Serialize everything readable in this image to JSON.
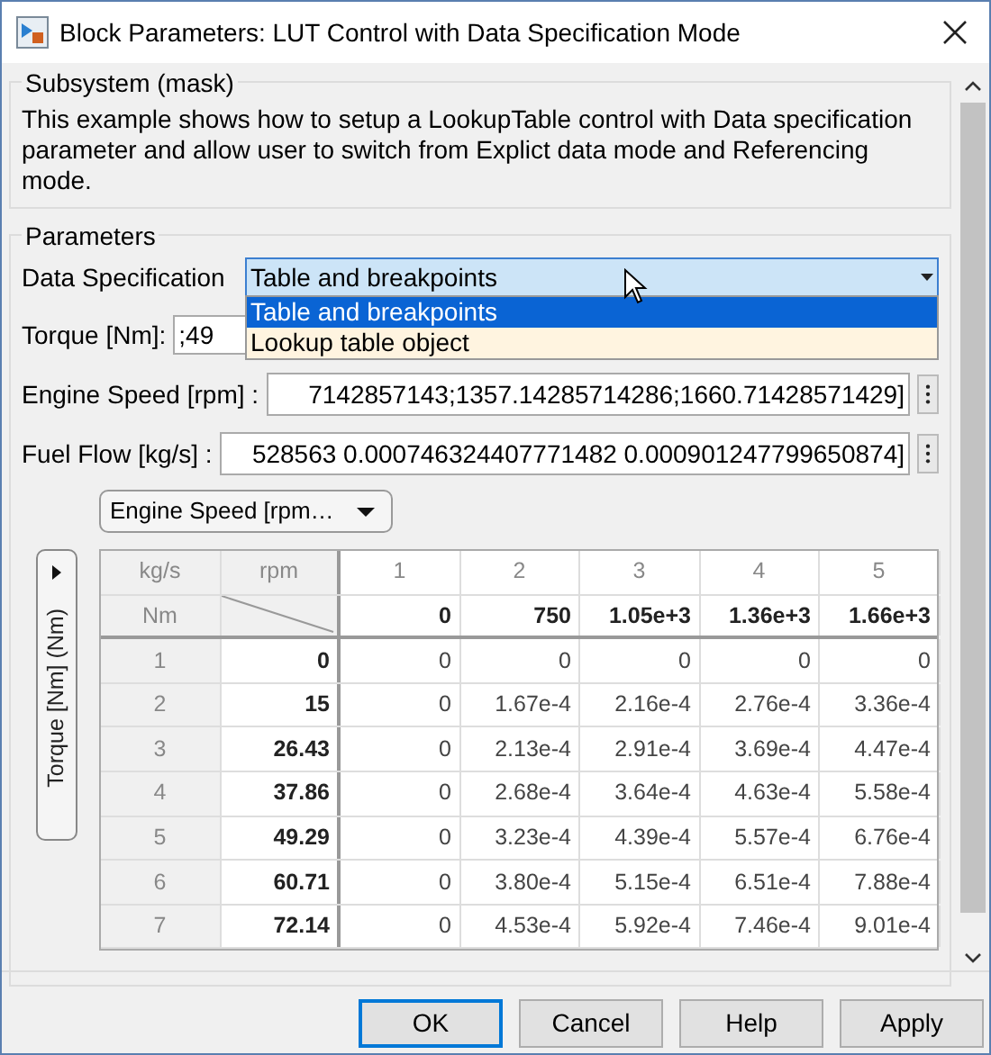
{
  "window": {
    "title": "Block Parameters: LUT Control with Data Specification Mode"
  },
  "description_group": {
    "title": "Subsystem (mask)",
    "text": "This example shows how to setup a LookupTable control with Data specification parameter and allow user to switch from Explict data mode and Referencing mode."
  },
  "parameters": {
    "title": "Parameters",
    "data_specification": {
      "label": "Data Specification",
      "value": "Table and breakpoints",
      "expanded": true,
      "options": [
        {
          "label": "Table and breakpoints",
          "selected": true
        },
        {
          "label": "Lookup table object",
          "selected": false
        }
      ]
    },
    "fields": [
      {
        "label": "Torque [Nm]:",
        "value": ";49"
      },
      {
        "label": "Engine Speed [rpm] :",
        "value": "7142857143;1357.14285714286;1660.71428571429]"
      },
      {
        "label": "Fuel Flow [kg/s] :",
        "value": "528563 0.000746324407771482 0.000901247799650874]"
      }
    ]
  },
  "axis_selector": {
    "value": "Engine Speed [rpm…"
  },
  "side_toggle": {
    "label": "Torque [Nm] (Nm)"
  },
  "table": {
    "corner": {
      "top_left": "kg/s",
      "top_right": "rpm",
      "bottom_left": "Nm"
    },
    "column_numbers": [
      "1",
      "2",
      "3",
      "4",
      "5"
    ],
    "column_breakpoints": [
      "0",
      "750",
      "1.05e+3",
      "1.36e+3",
      "1.66e+3"
    ],
    "rows": [
      {
        "index": "1",
        "breakpoint": "0",
        "values": [
          "0",
          "0",
          "0",
          "0",
          "0"
        ]
      },
      {
        "index": "2",
        "breakpoint": "15",
        "values": [
          "0",
          "1.67e-4",
          "2.16e-4",
          "2.76e-4",
          "3.36e-4"
        ]
      },
      {
        "index": "3",
        "breakpoint": "26.43",
        "values": [
          "0",
          "2.13e-4",
          "2.91e-4",
          "3.69e-4",
          "4.47e-4"
        ]
      },
      {
        "index": "4",
        "breakpoint": "37.86",
        "values": [
          "0",
          "2.68e-4",
          "3.64e-4",
          "4.63e-4",
          "5.58e-4"
        ]
      },
      {
        "index": "5",
        "breakpoint": "49.29",
        "values": [
          "0",
          "3.23e-4",
          "4.39e-4",
          "5.57e-4",
          "6.76e-4"
        ]
      },
      {
        "index": "6",
        "breakpoint": "60.71",
        "values": [
          "0",
          "3.80e-4",
          "5.15e-4",
          "6.51e-4",
          "7.88e-4"
        ]
      },
      {
        "index": "7",
        "breakpoint": "72.14",
        "values": [
          "0",
          "4.53e-4",
          "5.92e-4",
          "7.46e-4",
          "9.01e-4"
        ]
      }
    ]
  },
  "buttons": [
    {
      "label": "OK",
      "default": true
    },
    {
      "label": "Cancel",
      "default": false
    },
    {
      "label": "Help",
      "default": false
    },
    {
      "label": "Apply",
      "default": false
    }
  ]
}
